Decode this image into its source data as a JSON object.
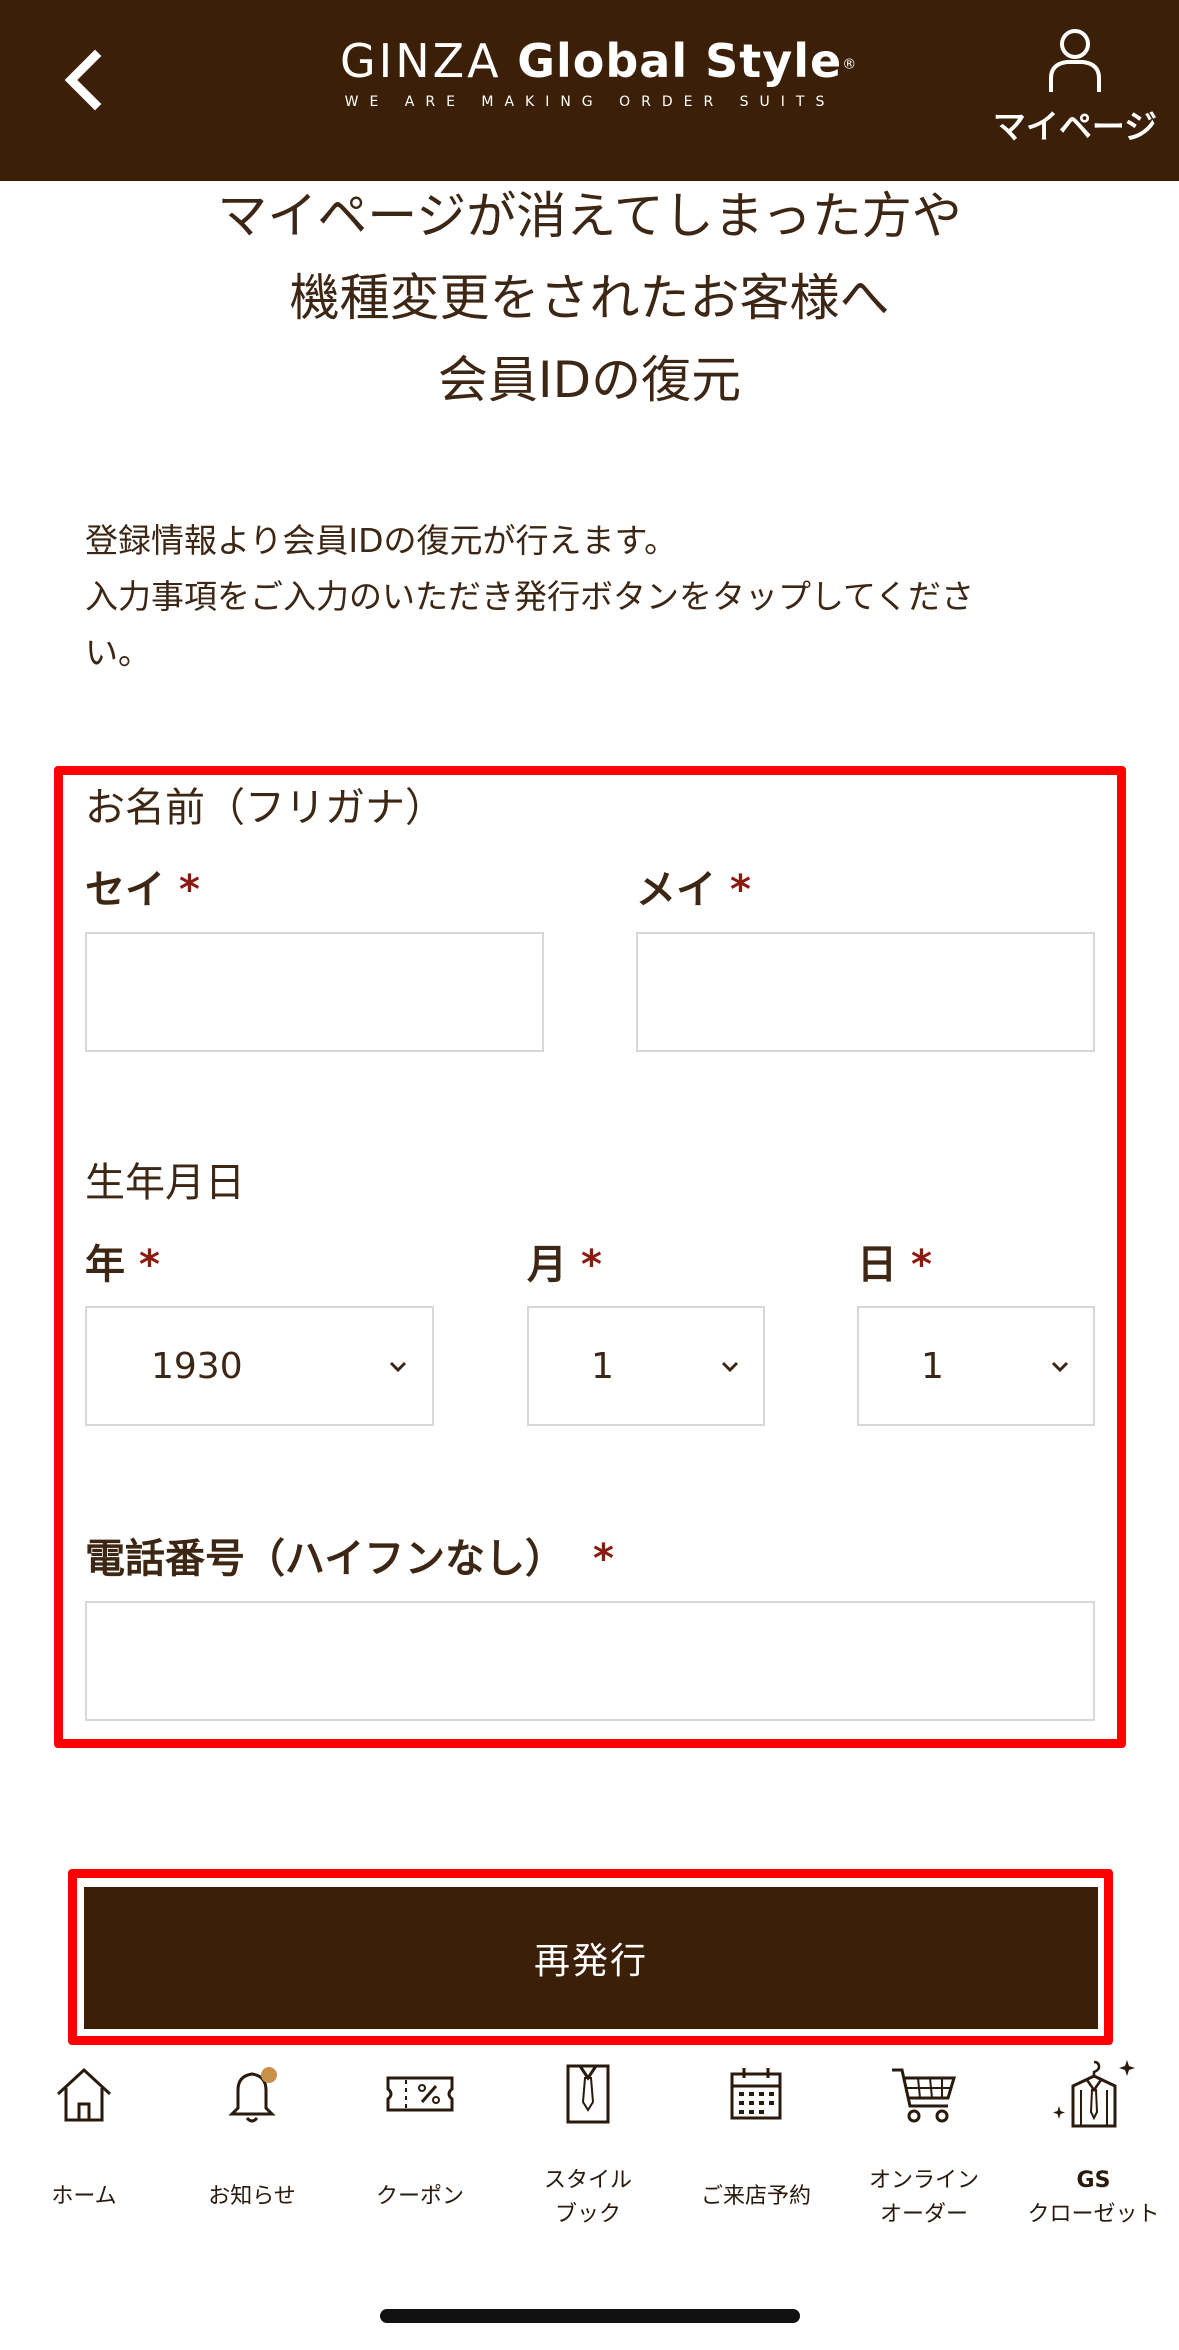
{
  "header": {
    "brand_title_thin": "GINZA",
    "brand_title_bold": "Global Style",
    "brand_reg": "®",
    "brand_tagline": "WE ARE MAKING ORDER SUITS",
    "mypage_label": "マイページ"
  },
  "title": {
    "line1": "マイページが消えてしまった方や",
    "line2": "機種変更をされたお客様へ",
    "line3": "会員IDの復元"
  },
  "description": {
    "line1": "登録情報より会員IDの復元が行えます。",
    "line2": "入力事項をご入力のいただき発行ボタンをタップしてくださ",
    "line3": "い。"
  },
  "form": {
    "name_section": "お名前（フリガナ）",
    "sei_label": "セイ",
    "mei_label": "メイ",
    "required_mark": "*",
    "sei_value": "",
    "mei_value": "",
    "birthday_section": "生年月日",
    "year_label": "年",
    "month_label": "月",
    "day_label": "日",
    "year_value": "1930",
    "month_value": "1",
    "day_value": "1",
    "phone_label": "電話番号（ハイフンなし）",
    "phone_value": ""
  },
  "submit_label": "再発行",
  "tabbar": {
    "home": "ホーム",
    "news": "お知らせ",
    "coupon": "クーポン",
    "stylebook_1": "スタイル",
    "stylebook_2": "ブック",
    "reserve": "ご来店予約",
    "online_1": "オンライン",
    "online_2": "オーダー",
    "closet_1": "GS",
    "closet_2": "クローゼット"
  },
  "colors": {
    "brand_brown": "#3b2007",
    "text_brown": "#3d2714",
    "required_red": "#8b1a10",
    "highlight_red": "#ff0000",
    "notification_dot": "#c8914a"
  }
}
